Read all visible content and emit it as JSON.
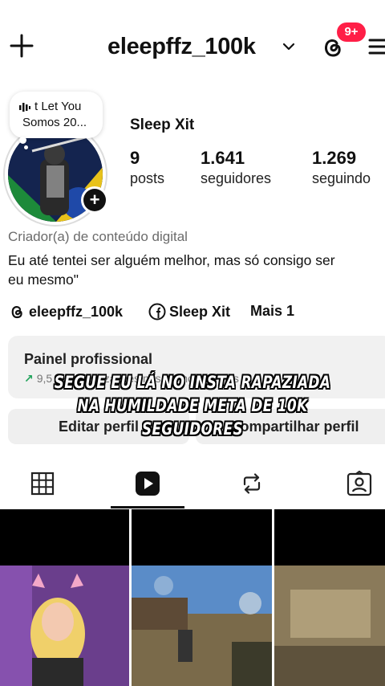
{
  "header": {
    "username": "eleepffz_100k",
    "notification_badge": "9+"
  },
  "profile": {
    "note_line1_prefix": "t Let You",
    "note_line2": "Somos 20...",
    "display_name": "Sleep Xit",
    "stats": [
      {
        "value": "9",
        "label": "posts"
      },
      {
        "value": "1.641",
        "label": "seguidores"
      },
      {
        "value": "1.269",
        "label": "seguindo"
      }
    ],
    "category": "Criador(a) de conteúdo digital",
    "bio_line1": "Eu até tentei ser alguém melhor, mas só consigo ser",
    "bio_line2": "eu mesmo\"",
    "links": [
      {
        "icon": "threads-icon",
        "label": "eleepffz_100k"
      },
      {
        "icon": "facebook-icon",
        "label": "Sleep Xit"
      },
      {
        "icon": "",
        "label": "Mais 1"
      }
    ]
  },
  "professional_panel": {
    "title": "Painel profissional",
    "subtitle": "9,5 mil visualizações nos últimos 30 dias"
  },
  "buttons": {
    "edit_profile": "Editar perfil",
    "share_profile": "Compartilhar perfil"
  },
  "overlay_caption": {
    "line1": "SEGUE EU LÁ NO INSTA RAPAZIADA",
    "line2": "NA HUMILDADE META DE 10K",
    "line3": "SEGUIDORES"
  },
  "tabs": [
    "posts-grid",
    "reels",
    "reposts",
    "tagged"
  ],
  "colors": {
    "badge": "#ff1f47",
    "accent_green": "#21a35b",
    "panel_bg": "#f1f1f1"
  }
}
